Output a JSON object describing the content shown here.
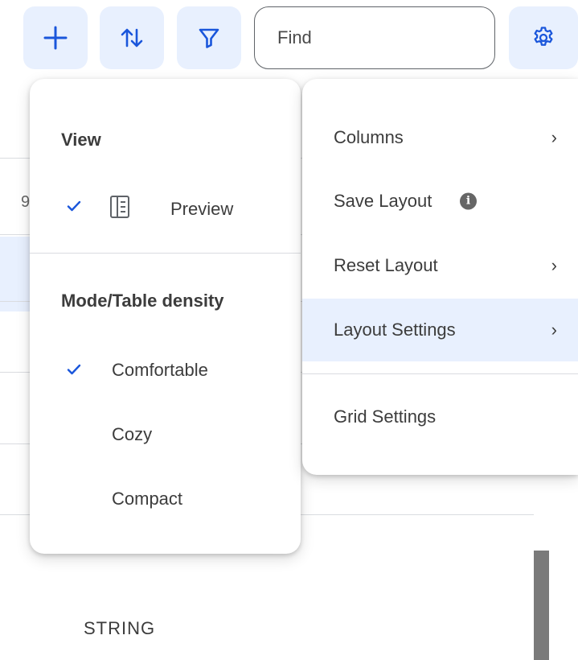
{
  "toolbar": {
    "add_icon": "plus-icon",
    "sort_icon": "sort-arrows-icon",
    "filter_icon": "funnel-icon",
    "settings_icon": "gear-icon",
    "find_placeholder": "Find",
    "accent_color": "#1a56db",
    "button_bg": "#e8f0fe"
  },
  "grid": {
    "peek_text": "STRING",
    "peek_left_text": "9"
  },
  "view_menu": {
    "view_title": "View",
    "preview": {
      "label": "Preview",
      "checked": true,
      "icon": "preview-panel-icon"
    },
    "density_title": "Mode/Table density",
    "density_options": [
      {
        "label": "Comfortable",
        "checked": true
      },
      {
        "label": "Cozy",
        "checked": false
      },
      {
        "label": "Compact",
        "checked": false
      }
    ]
  },
  "settings_menu": {
    "items": [
      {
        "label": "Columns",
        "has_submenu": true
      },
      {
        "label": "Save Layout",
        "info_icon": true
      },
      {
        "label": "Reset Layout",
        "has_submenu": true
      },
      {
        "label": "Layout Settings",
        "has_submenu": true,
        "active": true
      },
      {
        "label": "Grid Settings",
        "has_submenu": false
      }
    ],
    "chevron": "›",
    "info_glyph": "i"
  }
}
